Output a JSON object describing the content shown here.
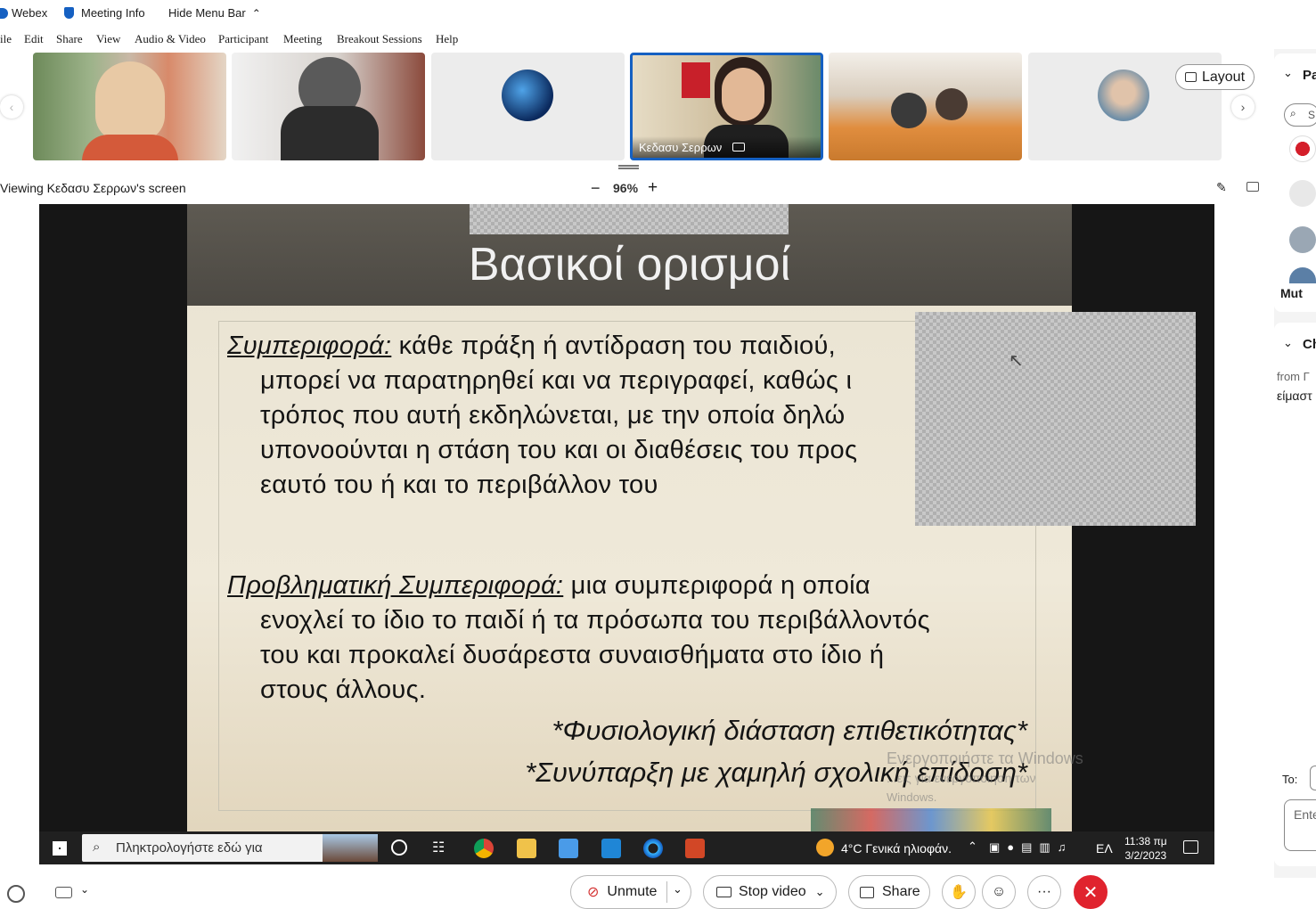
{
  "titlebar": {
    "app_name": "Webex",
    "meeting_info": "Meeting Info",
    "hide_menu_bar": "Hide Menu Bar"
  },
  "menu": {
    "items": [
      "ile",
      "Edit",
      "Share",
      "View",
      "Audio & Video",
      "Participant",
      "Meeting",
      "Breakout Sessions",
      "Help"
    ]
  },
  "participants": {
    "active_speaker_name": "Κεδασυ Σερρων",
    "layout_label": "Layout"
  },
  "view_bar": {
    "viewing_text": "Viewing Κεδασυ Σερρων's screen",
    "zoom": "96%",
    "zoom_out": "−",
    "zoom_in": "+"
  },
  "slide": {
    "title": "Βασικοί ορισμοί",
    "p1_term": "Συμπεριφορά:",
    "p1_line1": " κάθε πράξη ή αντίδραση του παιδιού,",
    "p1_line2": "μπορεί να παρατηρηθεί και να περιγραφεί, καθώς ι",
    "p1_line3": "τρόπος που αυτή εκδηλώνεται, με την οποία δηλώ",
    "p1_line4": "υπονοούνται η στάση του και οι διαθέσεις του προς",
    "p1_line5": "εαυτό του ή και το περιβάλλον του",
    "p2_term": "Προβληματική Συμπεριφορά:",
    "p2_line1": " μια συμπεριφορά η οποία",
    "p2_line2": "ενοχλεί το ίδιο το παιδί ή τα πρόσωπα του περιβάλλοντός",
    "p2_line3": "του και προκαλεί δυσάρεστα συναισθήματα στο ίδιο ή",
    "p2_line4": "στους άλλους.",
    "note1": "*Φυσιολογική διάσταση επιθετικότητας*",
    "note2": "*Συνύπαρξη με χαμηλή σχολική επίδοση*"
  },
  "watermark": {
    "line1": "Ενεργοποιήστε τα Windows",
    "line2": "...εις για ενεργοποίηση των",
    "line3": "Windows."
  },
  "taskbar": {
    "search_placeholder": "Πληκτρολογήστε εδώ για",
    "weather": "4°C  Γενικά ηλιοφάν.",
    "lang": "ΕΛ",
    "time": "11:38 πμ",
    "date": "3/2/2023"
  },
  "right_panel": {
    "participants_header": "Pa",
    "search": "S",
    "muted": "Mut",
    "chat_header": "Ch",
    "chat_from": "from Γ",
    "chat_msg": "είμαστ",
    "to_label": "To:",
    "enter_placeholder": "Ente"
  },
  "bottom": {
    "unmute": "Unmute",
    "stop_video": "Stop video",
    "share": "Share",
    "more": "···"
  },
  "colors": {
    "accent": "#1560c2",
    "end_call": "#e0232e",
    "mute_red": "#d32f2f"
  }
}
